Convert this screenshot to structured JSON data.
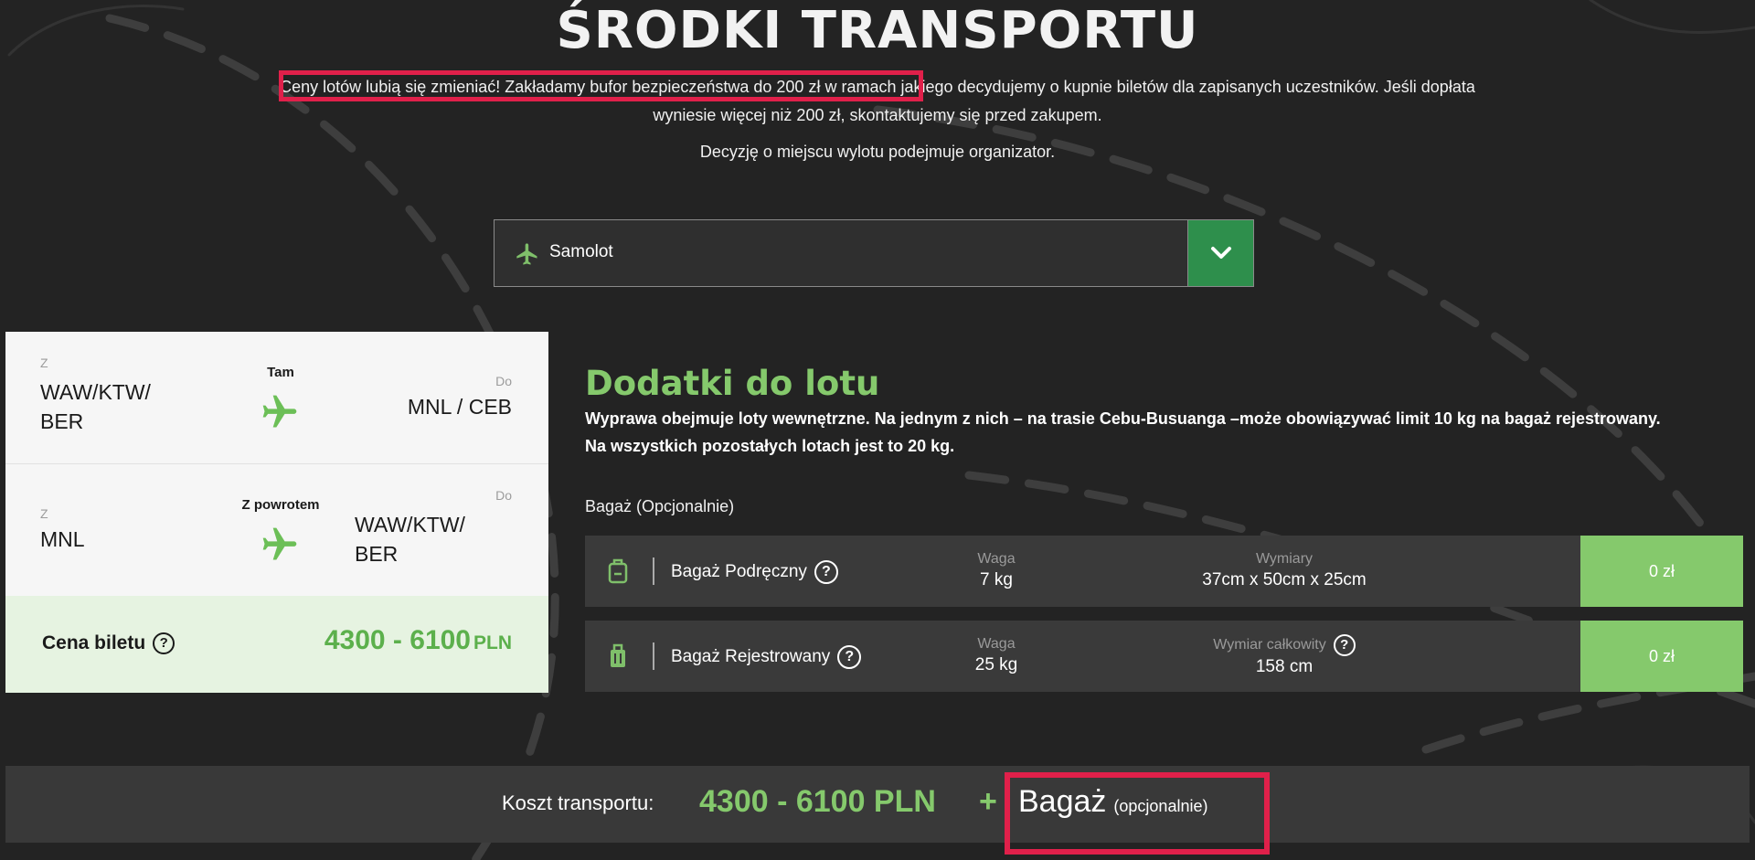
{
  "header": {
    "title": "ŚRODKI TRANSPORTU",
    "intro_highlight": "Ceny lotów lubią się zmieniać! Zakładamy bufor bezpieczeństwa do 200 zł",
    "intro_rest": " w ramach jakiego decydujemy o kupnie biletów dla zapisanych uczestników. Jeśli dopłata wyniesie więcej niż 200 zł, skontaktujemy się przed zakupem.",
    "intro_organizer": "Decyzję o miejscu wylotu podejmuje organizator."
  },
  "transport_select": {
    "selected": "Samolot",
    "icon": "airplane-icon",
    "toggle_icon": "chevron-down-icon"
  },
  "ticket": {
    "outbound": {
      "from_label": "Z",
      "from": "WAW/KTW/ BER",
      "direction": "Tam",
      "to_label": "Do",
      "to": "MNL / CEB"
    },
    "return": {
      "from_label": "Z",
      "from": "MNL",
      "direction": "Z powrotem",
      "to_label": "Do",
      "to": "WAW/KTW/ BER"
    },
    "price_label": "Cena biletu",
    "price_value": "4300 - 6100",
    "price_unit": "PLN"
  },
  "extras": {
    "title": "Dodatki do lotu",
    "description": "Wyprawa obejmuje loty wewnętrzne. Na jednym z nich – na trasie Cebu-Busuanga –może obowiązywać limit 10 kg na bagaż rejestrowany. Na wszystkich pozostałych lotach jest to 20 kg.",
    "baggage_heading": "Bagaż (Opcjonalnie)",
    "baggage": [
      {
        "name": "Bagaż Podręczny",
        "icon": "carry-on-bag-icon",
        "weight_label": "Waga",
        "weight": "7 kg",
        "dim_label": "Wymiary",
        "dim": "37cm x 50cm x 25cm",
        "price": "0 zł"
      },
      {
        "name": "Bagaż Rejestrowany",
        "icon": "checked-luggage-icon",
        "weight_label": "Waga",
        "weight": "25 kg",
        "dim_label": "Wymiar całkowity",
        "dim": "158 cm",
        "price": "0 zł"
      }
    ]
  },
  "cost": {
    "label": "Koszt transportu:",
    "value": "4300 - 6100 PLN",
    "plus": "+",
    "baggage": "Bagaż",
    "optional": "(opcjonalnie)"
  },
  "colors": {
    "background": "#232323",
    "accent_green": "#85c96c",
    "dark_green": "#2e8f4c",
    "highlight_red": "#e0204a",
    "price_row_bg": "#e6f3e1"
  }
}
